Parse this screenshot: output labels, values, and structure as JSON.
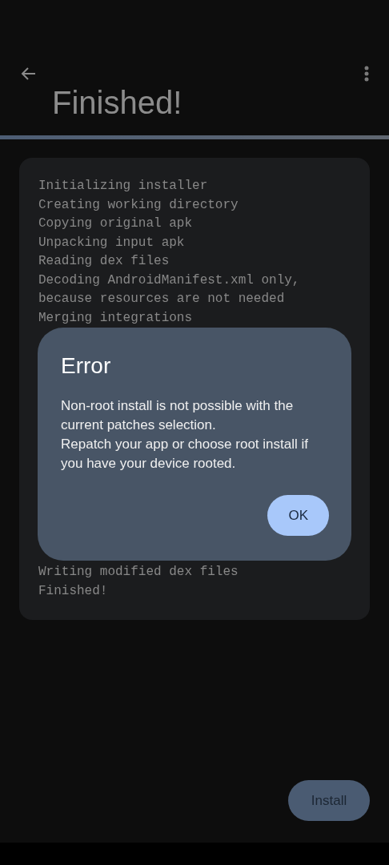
{
  "top_bar": {
    "title": "Finished!"
  },
  "progress": {
    "level": 1
  },
  "log": {
    "lines_above": [
      "Initializing installer",
      "Creating working directory",
      "Copying original apk",
      "Unpacking input apk",
      "Reading dex files",
      "Decoding AndroidManifest.xml only, because resources are not needed",
      "Merging integrations"
    ],
    "lines_below": [
      "Writing modified dex files",
      "Finished!"
    ]
  },
  "dialog": {
    "title": "Error",
    "message": "Non-root install is not possible with the current patches selection.\nRepatch your app or choose root install if you have your device rooted.",
    "buttons": [
      "OK"
    ]
  },
  "install_button": {
    "label": "Install"
  }
}
